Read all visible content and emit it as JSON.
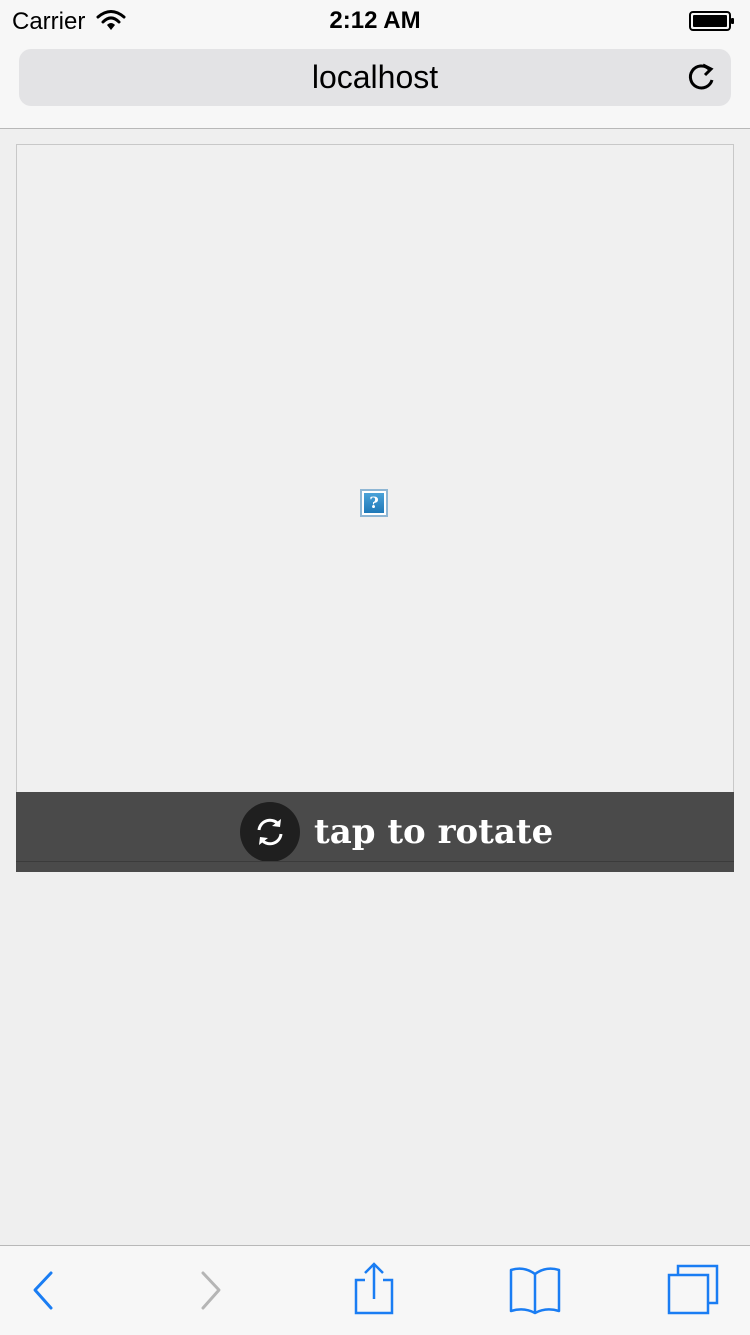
{
  "status_bar": {
    "carrier": "Carrier",
    "time": "2:12 AM"
  },
  "address_bar": {
    "url": "localhost"
  },
  "content": {
    "broken_image_glyph": "?",
    "rotate_label": "tap to rotate"
  },
  "toolbar": {
    "back": "chevron-left-icon",
    "forward": "chevron-right-icon",
    "share": "share-icon",
    "bookmarks": "book-icon",
    "tabs": "tabs-icon"
  },
  "colors": {
    "accent": "#1a7df3",
    "disabled": "#b5b5b5",
    "banner": "#4a4a4a"
  }
}
